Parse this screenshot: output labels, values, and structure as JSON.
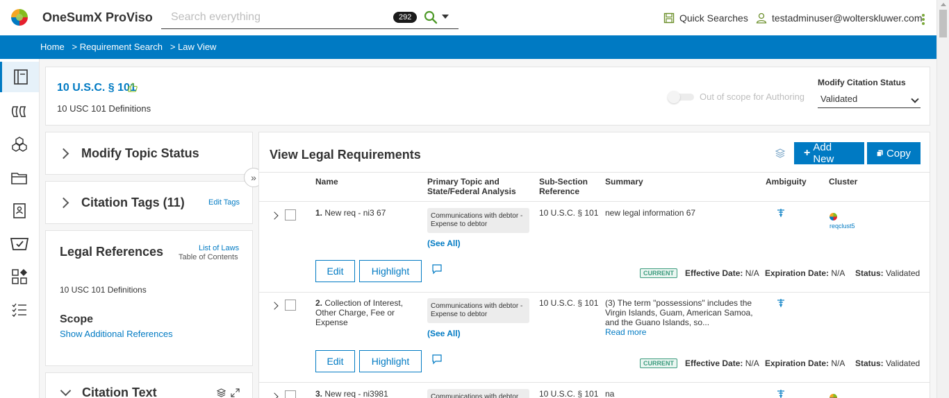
{
  "app": {
    "title": "OneSumX ProViso"
  },
  "search": {
    "placeholder": "Search everything",
    "count": "292"
  },
  "topbar": {
    "quick_searches": "Quick Searches",
    "user": "testadminuser@wolterskluwer.com"
  },
  "breadcrumbs": [
    "Home",
    ">",
    "Requirement Search",
    ">",
    "Law View"
  ],
  "citation": {
    "title": "10 U.S.C. § 101",
    "subtitle": "10 USC 101 Definitions",
    "toggle_label": "Out of scope for Authoring",
    "modify_status_label": "Modify Citation Status",
    "modify_status_value": "Validated"
  },
  "side": {
    "modify_topic_status": "Modify Topic Status",
    "citation_tags": "Citation Tags (11)",
    "edit_tags": "Edit Tags",
    "legal_references": "Legal References",
    "list_of_laws": "List of Laws",
    "table_of_contents": "Table of Contents",
    "definitions": "10 USC 101 Definitions",
    "scope": "Scope",
    "show_additional": "Show Additional References",
    "citation_text": "Citation Text"
  },
  "main": {
    "title": "View Legal Requirements",
    "add_new": "Add New",
    "copy": "Copy",
    "columns": {
      "name": "Name",
      "primary_topic": "Primary Topic and State/Federal Analysis",
      "subsection": "Sub-Section Reference",
      "summary": "Summary",
      "ambiguity": "Ambiguity",
      "cluster": "Cluster"
    },
    "rows": [
      {
        "num": "1.",
        "name": "New req - ni3 67",
        "topic": "Communications with debtor - Expense to debtor",
        "see_all": "(See All)",
        "subsection": "10 U.S.C. § 101",
        "summary": "new legal information 67",
        "read_more": "",
        "cluster": "reqclust5",
        "edit": "Edit",
        "highlight": "Highlight",
        "status_badge": "CURRENT",
        "effective_label": "Effective Date:",
        "effective_value": "N/A",
        "expiration_label": "Expiration Date:",
        "expiration_value": "N/A",
        "status_label": "Status:",
        "status_value": "Validated"
      },
      {
        "num": "2.",
        "name": "Collection of Interest, Other Charge, Fee or Expense",
        "topic": "Communications with debtor - Expense to debtor",
        "see_all": "(See All)",
        "subsection": "10 U.S.C. § 101",
        "summary": "(3) The term \"possessions\" includes the Virgin Islands, Guam, American Samoa, and the Guano Islands, so...",
        "read_more": "Read more",
        "cluster": "",
        "edit": "Edit",
        "highlight": "Highlight",
        "status_badge": "CURRENT",
        "effective_label": "Effective Date:",
        "effective_value": "N/A",
        "expiration_label": "Expiration Date:",
        "expiration_value": "N/A",
        "status_label": "Status:",
        "status_value": "Validated"
      },
      {
        "num": "3.",
        "name": "New req - ni3981",
        "topic": "Communications with debtor",
        "subsection": "10 U.S.C. § 101",
        "summary": "na"
      }
    ]
  }
}
